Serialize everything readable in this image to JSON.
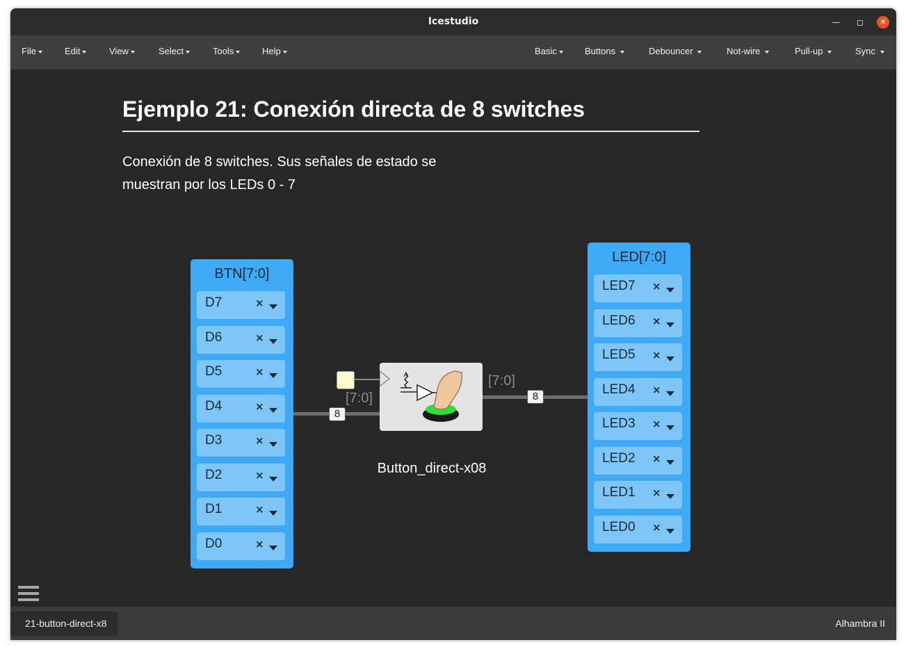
{
  "window": {
    "title": "Icestudio"
  },
  "menus": {
    "left": [
      "File",
      "Edit",
      "View",
      "Select",
      "Tools",
      "Help"
    ],
    "right": [
      "Basic",
      "Buttons",
      "Debouncer",
      "Not-wire",
      "Pull-up",
      "Sync"
    ]
  },
  "document": {
    "heading": "Ejemplo 21: Conexión directa de 8 switches",
    "description_lines": [
      "Conexión de 8 switches. Sus señales de estado se",
      "muestran por los LEDs 0 - 7"
    ]
  },
  "input_block": {
    "title": "BTN[7:0]",
    "pins": [
      "D7",
      "D6",
      "D5",
      "D4",
      "D3",
      "D2",
      "D1",
      "D0"
    ]
  },
  "output_block": {
    "title": "LED[7:0]",
    "pins": [
      "LED7",
      "LED6",
      "LED5",
      "LED4",
      "LED3",
      "LED2",
      "LED1",
      "LED0"
    ]
  },
  "wires": {
    "in_label": "[7:0]",
    "in_size": "8",
    "out_label": "[7:0]",
    "out_size": "8"
  },
  "module": {
    "name": "Button_direct-x08"
  },
  "pin_remove_glyph": "×",
  "colors": {
    "block": "#3fa9f5",
    "pin": "#7ec6f8",
    "close_button": "#e95420",
    "button_green": "#33dd33"
  },
  "statusbar": {
    "file_tab": "21-button-direct-x8",
    "board": "Alhambra II"
  }
}
